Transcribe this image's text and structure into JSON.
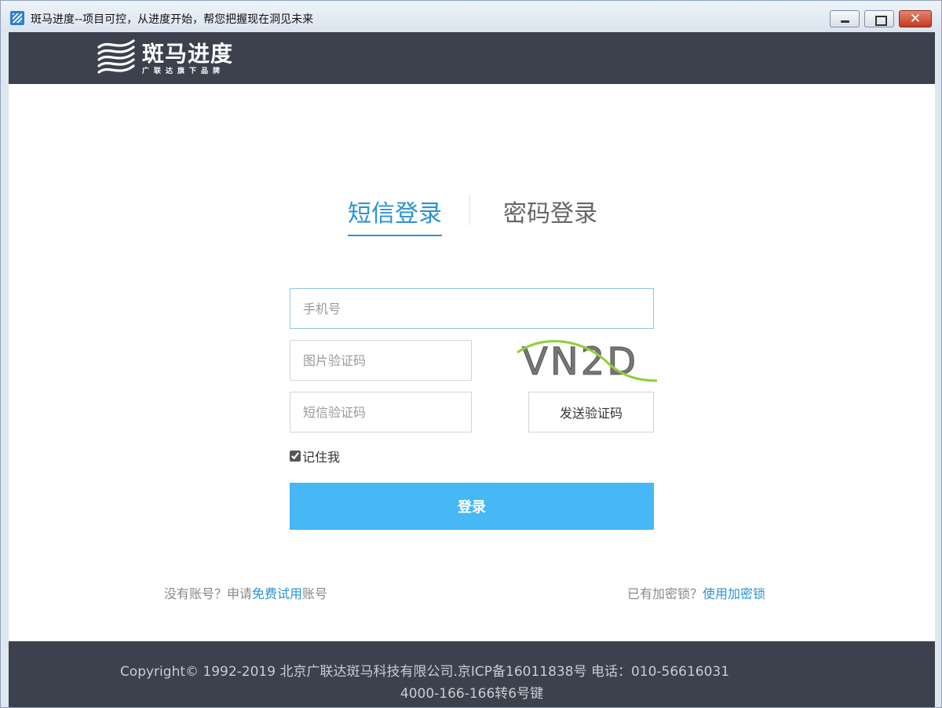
{
  "window": {
    "title": "斑马进度--项目可控，从进度开始，帮您把握现在洞见未来",
    "buttons": {
      "minimize": "",
      "maximize": "",
      "close": "✕"
    }
  },
  "header": {
    "logo_title": "斑马进度",
    "logo_subtitle": "广联达旗下品牌"
  },
  "tabs": [
    {
      "label": "短信登录",
      "active": true
    },
    {
      "label": "密码登录",
      "active": false
    }
  ],
  "form": {
    "phone_placeholder": "手机号",
    "captcha_placeholder": "图片验证码",
    "captcha_text": "VN2D",
    "sms_placeholder": "短信验证码",
    "send_code_label": "发送验证码",
    "remember_label": "记住我",
    "remember_checked": true,
    "login_label": "登录"
  },
  "links": {
    "no_account_prefix": "没有账号？申请",
    "free_trial": "免费试用",
    "no_account_suffix": "账号",
    "has_key_prefix": "已有加密锁？",
    "use_key": "使用加密锁"
  },
  "footer": {
    "line1": "Copyright© 1992-2019 北京广联达斑马科技有限公司.京ICP备16011838号 电话：010-56616031",
    "line2": "4000-166-166转6号键"
  },
  "colors": {
    "accent": "#2b93d2",
    "login_button": "#46b8f5",
    "header_bg": "#3c414d",
    "captcha_curve": "#8fcf3c"
  }
}
